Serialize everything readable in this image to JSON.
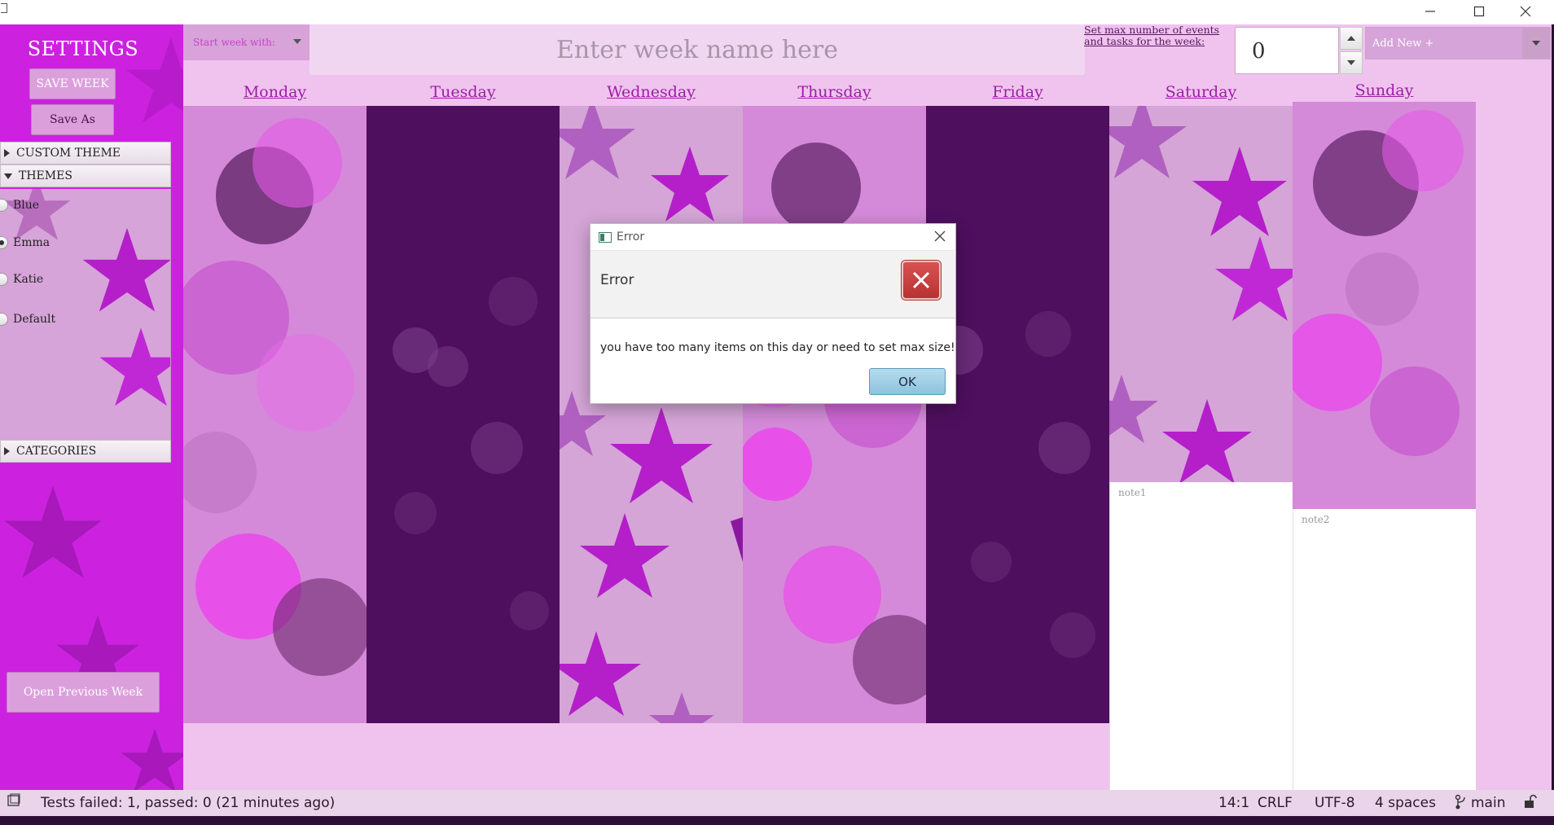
{
  "window": {
    "minimize_icon": "minimize-icon",
    "maximize_icon": "maximize-icon",
    "close_icon": "close-icon"
  },
  "sidebar": {
    "title": "SETTINGS",
    "save_week": "SAVE WEEK",
    "save_as": "Save As",
    "custom_theme": "CUSTOM THEME",
    "themes": "THEMES",
    "theme_options": [
      "Blue",
      "Emma",
      "Katie",
      "Default"
    ],
    "selected_theme": "Emma",
    "categories": "CATEGORIES",
    "open_previous": "Open Previous Week"
  },
  "toolbar": {
    "start_week_label": "Start week with:",
    "week_name_placeholder": "Enter week name here",
    "max_label": "Set max number of events and tasks for the week:",
    "max_value": "0",
    "add_new": "Add New +"
  },
  "days": [
    "Monday",
    "Tuesday",
    "Wednesday",
    "Thursday",
    "Friday",
    "Saturday",
    "Sunday"
  ],
  "notes": {
    "saturday": "note1",
    "sunday": "note2"
  },
  "dialog": {
    "title": "Error",
    "header": "Error",
    "message": "you have too many items on this day or need to set max size!",
    "ok": "OK"
  },
  "statusbar": {
    "tests": "Tests failed: 1, passed: 0 (21 minutes ago)",
    "position": "14:1",
    "line_ending": "CRLF",
    "encoding": "UTF-8",
    "indent": "4 spaces",
    "branch": "main"
  },
  "colors": {
    "sidebar": "#cc22e0",
    "app_bg": "#f0c3ef",
    "accent_text": "#9a1ea3",
    "dark_column": "#4e0f5e"
  }
}
